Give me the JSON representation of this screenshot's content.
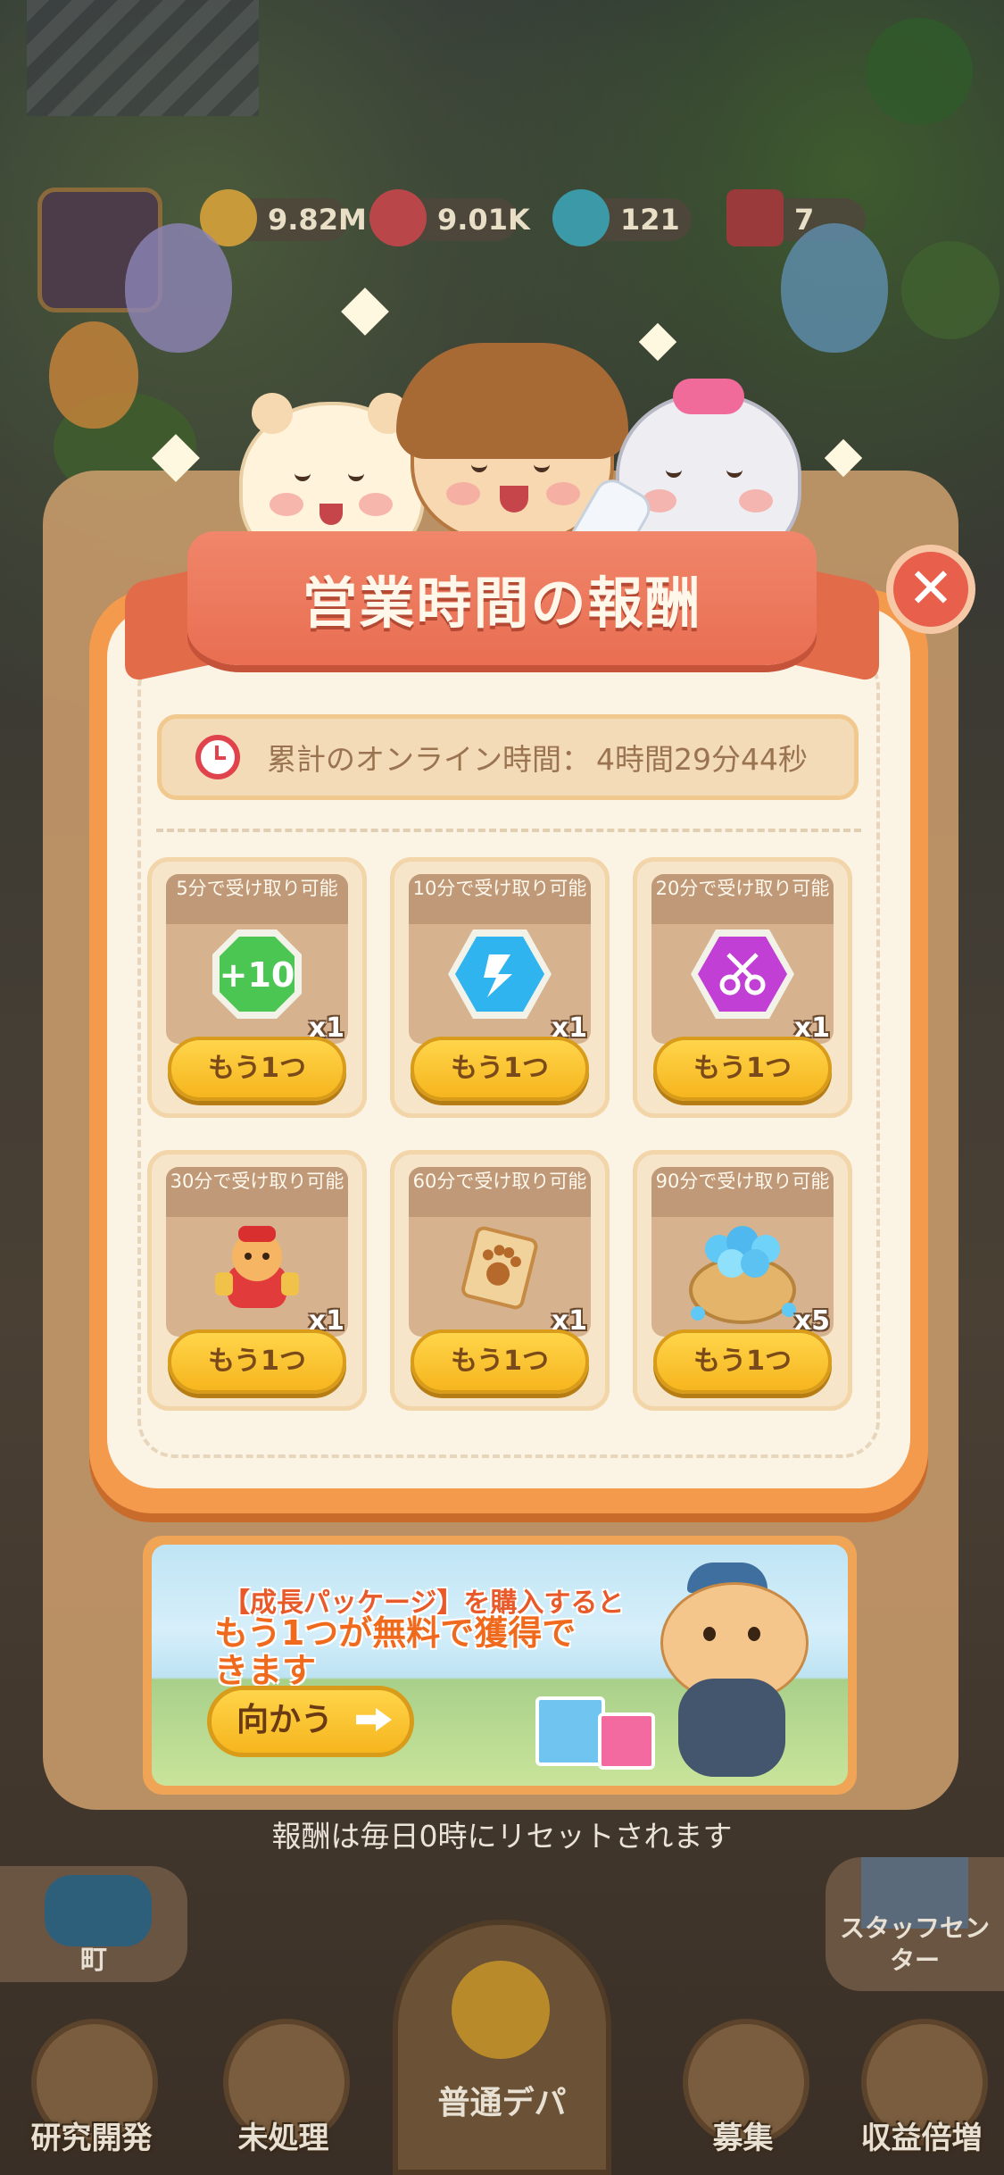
{
  "hud": {
    "coins": "9.82M",
    "hearts": "9.01K",
    "gems": "121",
    "tickets": "7"
  },
  "dialog": {
    "title": "営業時間の報酬",
    "online_time_label": "累計のオンライン時間：",
    "online_time_value": "4時間29分44秒",
    "rewards": [
      {
        "condition": "5分で受け取り可能",
        "quantity": "x1",
        "button": "もう1つ",
        "item": "plus-ten-icon"
      },
      {
        "condition": "10分で受け取り可能",
        "quantity": "x1",
        "button": "もう1つ",
        "item": "blue-crystal-icon"
      },
      {
        "condition": "20分で受け取り可能",
        "quantity": "x1",
        "button": "もう1つ",
        "item": "scissors-gem-icon"
      },
      {
        "condition": "30分で受け取り可能",
        "quantity": "x1",
        "button": "もう1つ",
        "item": "lucky-hamster-icon"
      },
      {
        "condition": "60分で受け取り可能",
        "quantity": "x1",
        "button": "もう1つ",
        "item": "paw-scroll-icon"
      },
      {
        "condition": "90分で受け取り可能",
        "quantity": "x5",
        "button": "もう1つ",
        "item": "diamond-bag-icon"
      }
    ],
    "promo": {
      "line1": "【成長パッケージ】を購入すると",
      "line2": "もう1つが無料で獲得できます",
      "go_button": "向かう"
    },
    "reset_note": "報酬は毎日0時にリセットされます"
  },
  "bottom_nav": {
    "town": "町",
    "staff_center": "スタッフセンター",
    "research": "研究開発",
    "pending": "未処理",
    "department": "普通デパ",
    "recruit": "募集",
    "profit_boost": "収益倍増"
  },
  "colors": {
    "panel_orange": "#f49a4c",
    "ribbon_red": "#e96e52",
    "button_yellow": "#f6b51e",
    "card_bg": "#f7e5c9"
  }
}
